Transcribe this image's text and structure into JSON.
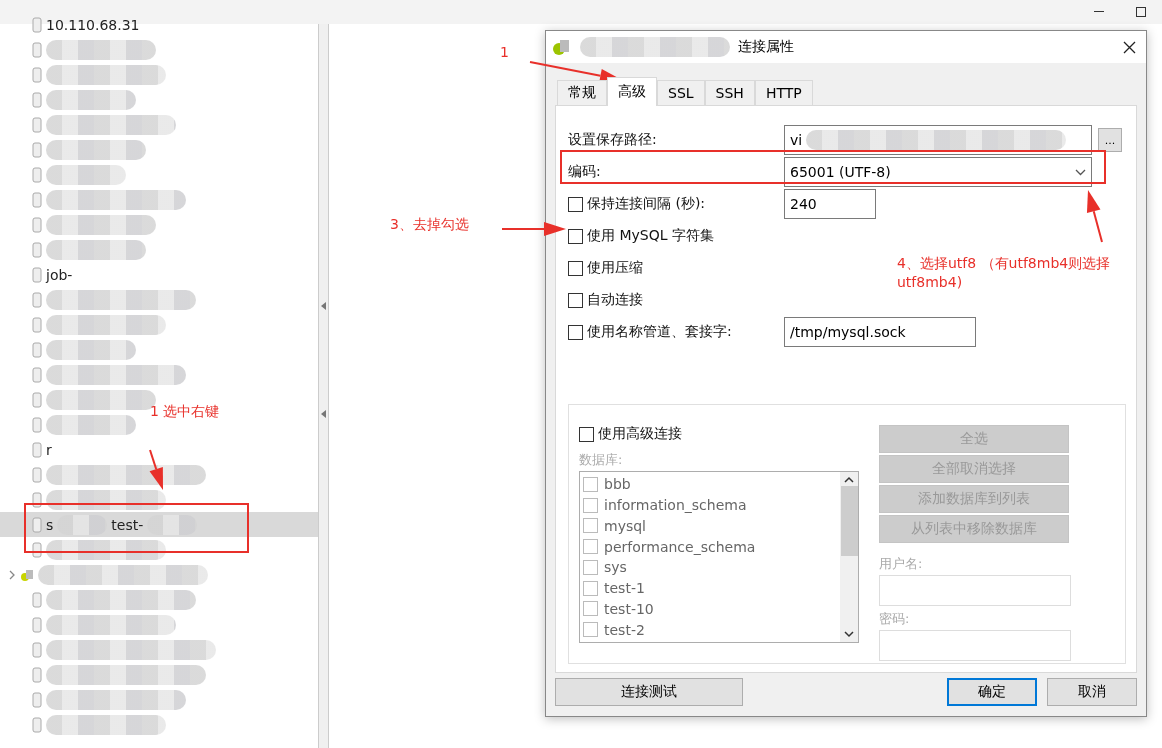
{
  "tree": {
    "items": [
      {
        "kind": "database",
        "text": "10.110.68.31",
        "selected": false
      },
      {
        "kind": "database",
        "selected": false
      },
      {
        "kind": "database",
        "selected": false
      },
      {
        "kind": "database",
        "selected": false
      },
      {
        "kind": "database",
        "selected": false
      },
      {
        "kind": "database",
        "selected": false
      },
      {
        "kind": "database",
        "selected": false
      },
      {
        "kind": "database",
        "selected": false
      },
      {
        "kind": "database",
        "selected": false
      },
      {
        "kind": "database",
        "selected": false
      },
      {
        "kind": "database",
        "text": "job-",
        "selected": false
      },
      {
        "kind": "database",
        "selected": false
      },
      {
        "kind": "database",
        "selected": false
      },
      {
        "kind": "database",
        "selected": false
      },
      {
        "kind": "database",
        "selected": false
      },
      {
        "kind": "database",
        "selected": false
      },
      {
        "kind": "database",
        "selected": false
      },
      {
        "kind": "database",
        "text": "r",
        "selected": false
      },
      {
        "kind": "database",
        "selected": false
      },
      {
        "kind": "database",
        "selected": false
      },
      {
        "kind": "database",
        "text": "s",
        "text_2": "test-",
        "selected": true
      },
      {
        "kind": "database",
        "selected": false
      },
      {
        "kind": "connection",
        "selected": false
      },
      {
        "kind": "database",
        "selected": false
      },
      {
        "kind": "database",
        "selected": false
      },
      {
        "kind": "database",
        "selected": false
      },
      {
        "kind": "database",
        "selected": false
      },
      {
        "kind": "database",
        "selected": false
      },
      {
        "kind": "database",
        "selected": false
      }
    ]
  },
  "dialog": {
    "title": "连接属性",
    "tabs": [
      {
        "label": "常规",
        "selected": false
      },
      {
        "label": "高级",
        "selected": true
      },
      {
        "label": "SSL",
        "selected": false
      },
      {
        "label": "SSH",
        "selected": false
      },
      {
        "label": "HTTP",
        "selected": false
      }
    ],
    "rows": [
      {
        "kind": "path",
        "label": "设置保存路径:",
        "value": "vi",
        "button": "..."
      },
      {
        "kind": "select",
        "label": "编码:",
        "value": "65001 (UTF-8)"
      },
      {
        "kind": "check_input",
        "label": "保持连接间隔 (秒):",
        "checked": false,
        "value": "240"
      },
      {
        "kind": "check",
        "label": "使用 MySQL 字符集",
        "checked": false
      },
      {
        "kind": "check",
        "label": "使用压缩",
        "checked": false
      },
      {
        "kind": "check",
        "label": "自动连接",
        "checked": false
      },
      {
        "kind": "check_input",
        "label": "使用名称管道、套接字:",
        "checked": false,
        "value": "/tmp/mysql.sock"
      }
    ],
    "advanced": {
      "label": "使用高级连接",
      "checked": false,
      "enabled": false,
      "db_label": "数据库:",
      "databases": [
        {
          "name": "bbb",
          "checked": false
        },
        {
          "name": "information_schema",
          "checked": false
        },
        {
          "name": "mysql",
          "checked": false
        },
        {
          "name": "performance_schema",
          "checked": false
        },
        {
          "name": "sys",
          "checked": false
        },
        {
          "name": "test-1",
          "checked": false
        },
        {
          "name": "test-10",
          "checked": false
        },
        {
          "name": "test-2",
          "checked": false
        }
      ],
      "buttons": [
        "全选",
        "全部取消选择",
        "添加数据库到列表",
        "从列表中移除数据库"
      ],
      "user_label": "用户名:",
      "password_label": "密码:"
    },
    "footer": {
      "test_button": "连接测试",
      "ok_button": "确定",
      "cancel_button": "取消"
    }
  },
  "annotations": {
    "step_1_tab": "1",
    "step_3": "3、去掉勾选",
    "step_4_line_1": "4、选择utf8 （有utf8mb4则选择",
    "step_4_line_2": "utf8mb4)",
    "step_1_tree": "1 选中右键"
  }
}
